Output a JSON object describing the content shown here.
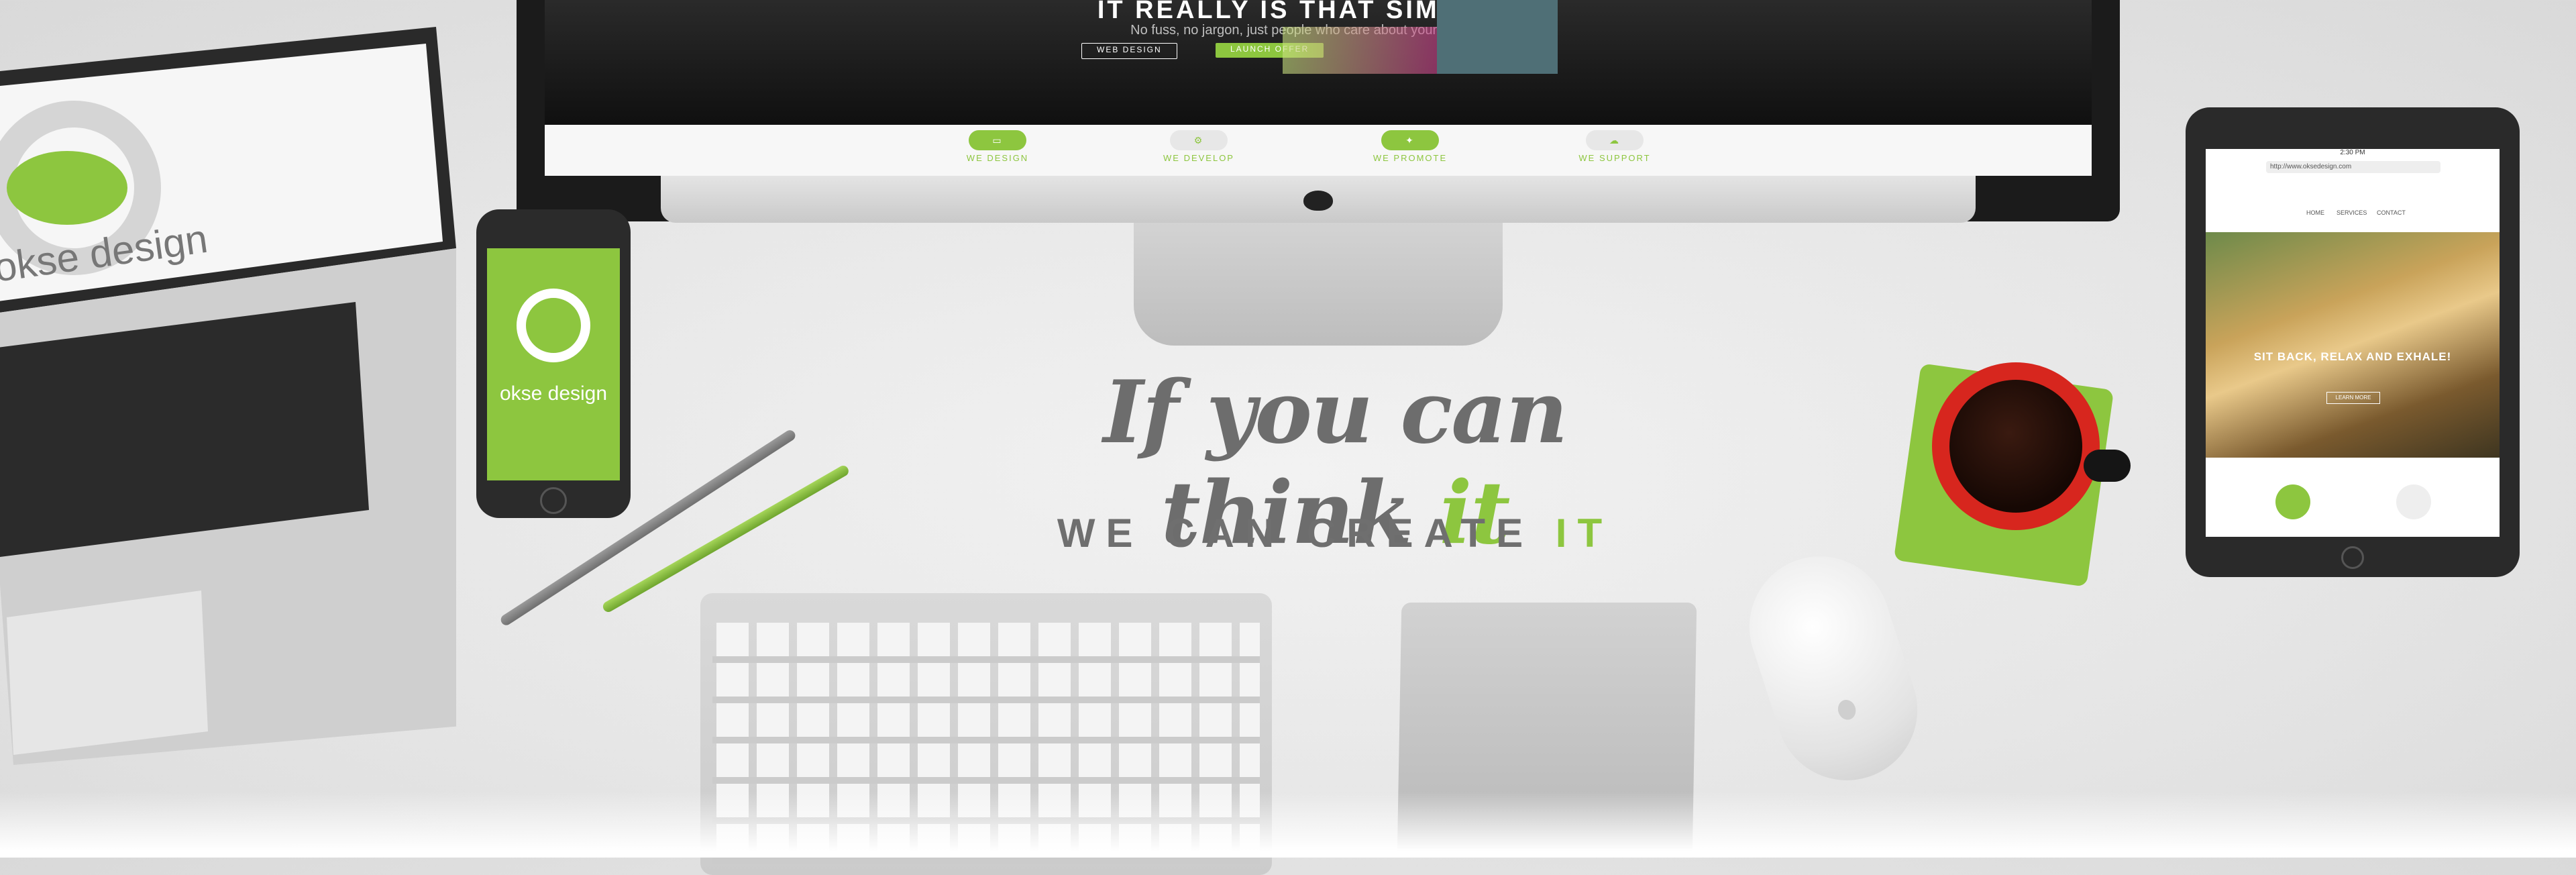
{
  "tagline": {
    "line1_main": "If you can think ",
    "line1_accent": "it",
    "line2_main": "WE CAN CREATE ",
    "line2_accent": "IT"
  },
  "imac_site": {
    "hero_title": "IT REALLY IS THAT SIMPLE!",
    "hero_subtitle": "No fuss, no jargon, just people who care about your vision",
    "button_1": "WEB DESIGN",
    "button_2": "LAUNCH OFFER",
    "services": [
      {
        "label": "WE DESIGN",
        "icon": "laptop-icon"
      },
      {
        "label": "WE DEVELOP",
        "icon": "code-icon"
      },
      {
        "label": "WE PROMOTE",
        "icon": "megaphone-icon"
      },
      {
        "label": "WE SUPPORT",
        "icon": "handshake-icon"
      }
    ]
  },
  "laptop_screen": {
    "brand": "okse design"
  },
  "phone_screen": {
    "brand": "okse design"
  },
  "tablet_site": {
    "url": "http://www.oksedesign.com",
    "time": "2:30 PM",
    "nav": [
      "HOME",
      "SERVICES",
      "CONTACT"
    ],
    "hero_title": "SIT BACK, RELAX AND EXHALE!",
    "hero_button": "LEARN MORE"
  },
  "colors": {
    "accent": "#8dc63f",
    "text_grey": "#6d6d6d",
    "cup_red": "#d7261e"
  }
}
